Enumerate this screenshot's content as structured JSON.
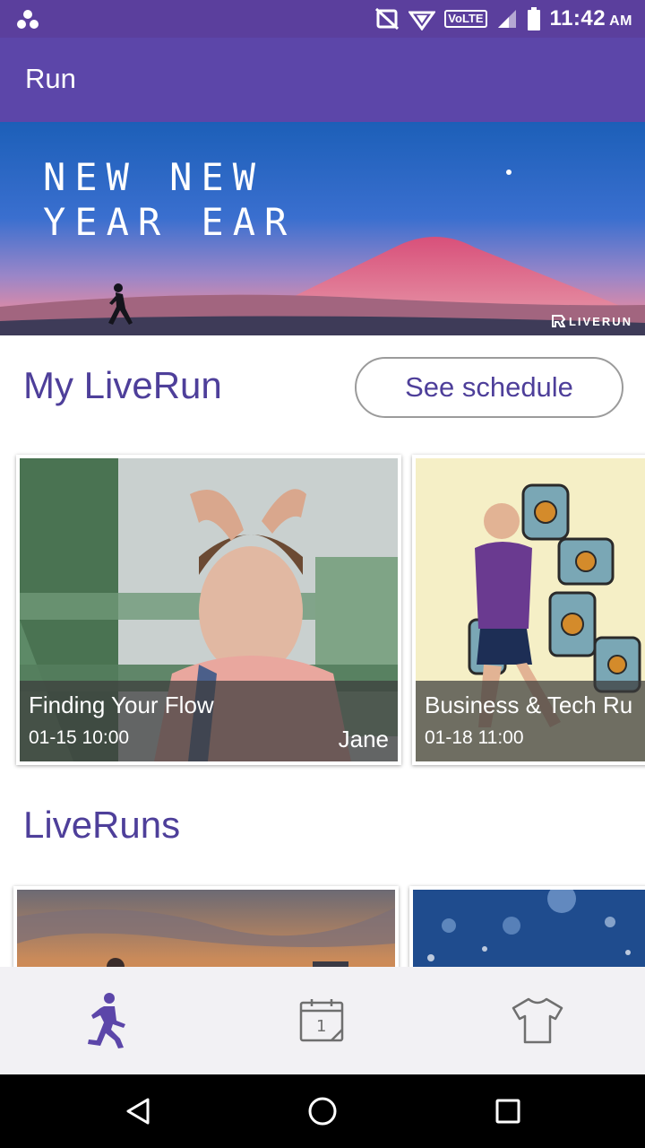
{
  "status_bar": {
    "time": "11:42",
    "ampm": "AM",
    "network": "VoLTE",
    "icons": [
      "app-dots-icon",
      "no-sim-icon",
      "hotspot-icon",
      "volte-icon",
      "signal-icon",
      "battery-icon"
    ]
  },
  "app_bar": {
    "title": "Run"
  },
  "banner": {
    "headline_lines": [
      "NEW NEW",
      "YEAR EAR"
    ],
    "brand": "LIVERUN"
  },
  "my_liverun": {
    "title": "My LiveRun",
    "schedule_button": "See schedule",
    "cards": [
      {
        "title": "Finding Your Flow",
        "datetime": "01-15 10:00",
        "host": "Jane"
      },
      {
        "title": "Business & Tech Ru",
        "datetime": "01-18 11:00",
        "host": ""
      }
    ]
  },
  "liveruns": {
    "title": "LiveRuns"
  },
  "bottom_nav": {
    "items": [
      {
        "icon": "runner-icon",
        "active": true
      },
      {
        "icon": "calendar-icon",
        "active": false,
        "day": "1"
      },
      {
        "icon": "tshirt-icon",
        "active": false
      }
    ]
  },
  "colors": {
    "status_bar": "#5b3f9d",
    "app_bar": "#5c46a9",
    "accent_text": "#4e3f9a",
    "nav_active": "#5c46a9",
    "nav_inactive": "#6f6f6f"
  }
}
